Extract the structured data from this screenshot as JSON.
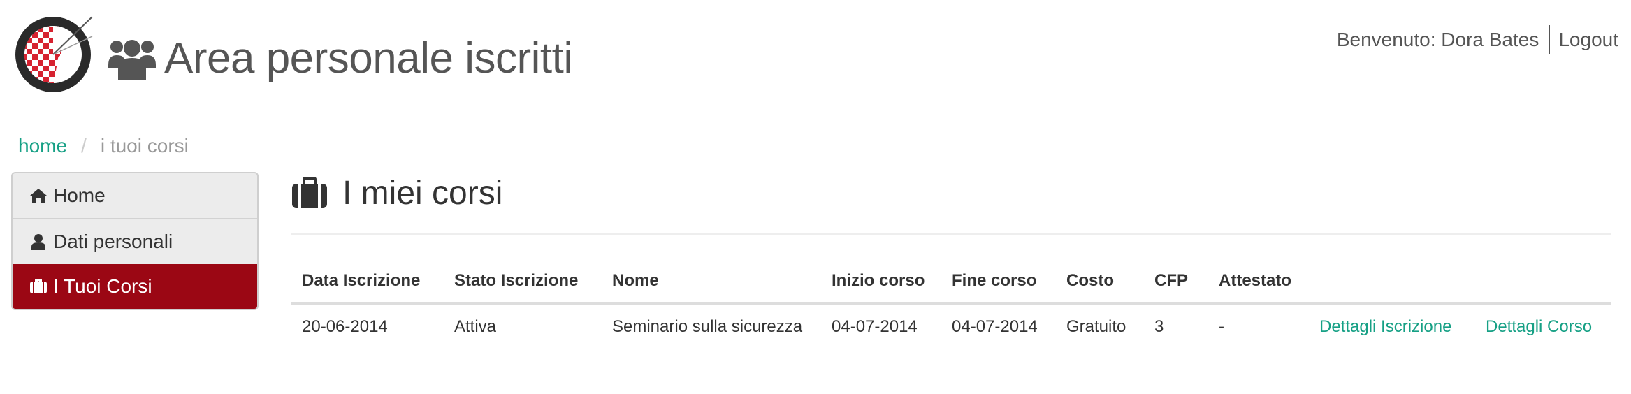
{
  "header": {
    "title": "Area personale iscritti",
    "welcome": "Benvenuto: Dora Bates",
    "logout_label": "Logout"
  },
  "breadcrumb": {
    "home": "home",
    "separator": "/",
    "current": "i tuoi corsi"
  },
  "sidebar": {
    "items": [
      {
        "label": "Home",
        "icon": "home-icon",
        "active": false
      },
      {
        "label": "Dati personali",
        "icon": "user-icon",
        "active": false
      },
      {
        "label": "I Tuoi Corsi",
        "icon": "briefcase-icon",
        "active": true
      }
    ]
  },
  "main": {
    "title": "I miei corsi",
    "title_icon": "briefcase-icon",
    "table": {
      "headers": [
        "Data Iscrizione",
        "Stato Iscrizione",
        "Nome",
        "Inizio corso",
        "Fine corso",
        "Costo",
        "CFP",
        "Attestato",
        "",
        ""
      ],
      "rows": [
        [
          "20-06-2014",
          "Attiva",
          "Seminario sulla sicurezza",
          "04-07-2014",
          "04-07-2014",
          "Gratuito",
          "3",
          "-",
          "Dettagli Iscrizione",
          "Dettagli Corso"
        ]
      ]
    }
  },
  "colors": {
    "accent": "#16a085",
    "active_nav": "#9b0714",
    "logo_red": "#d62230"
  }
}
